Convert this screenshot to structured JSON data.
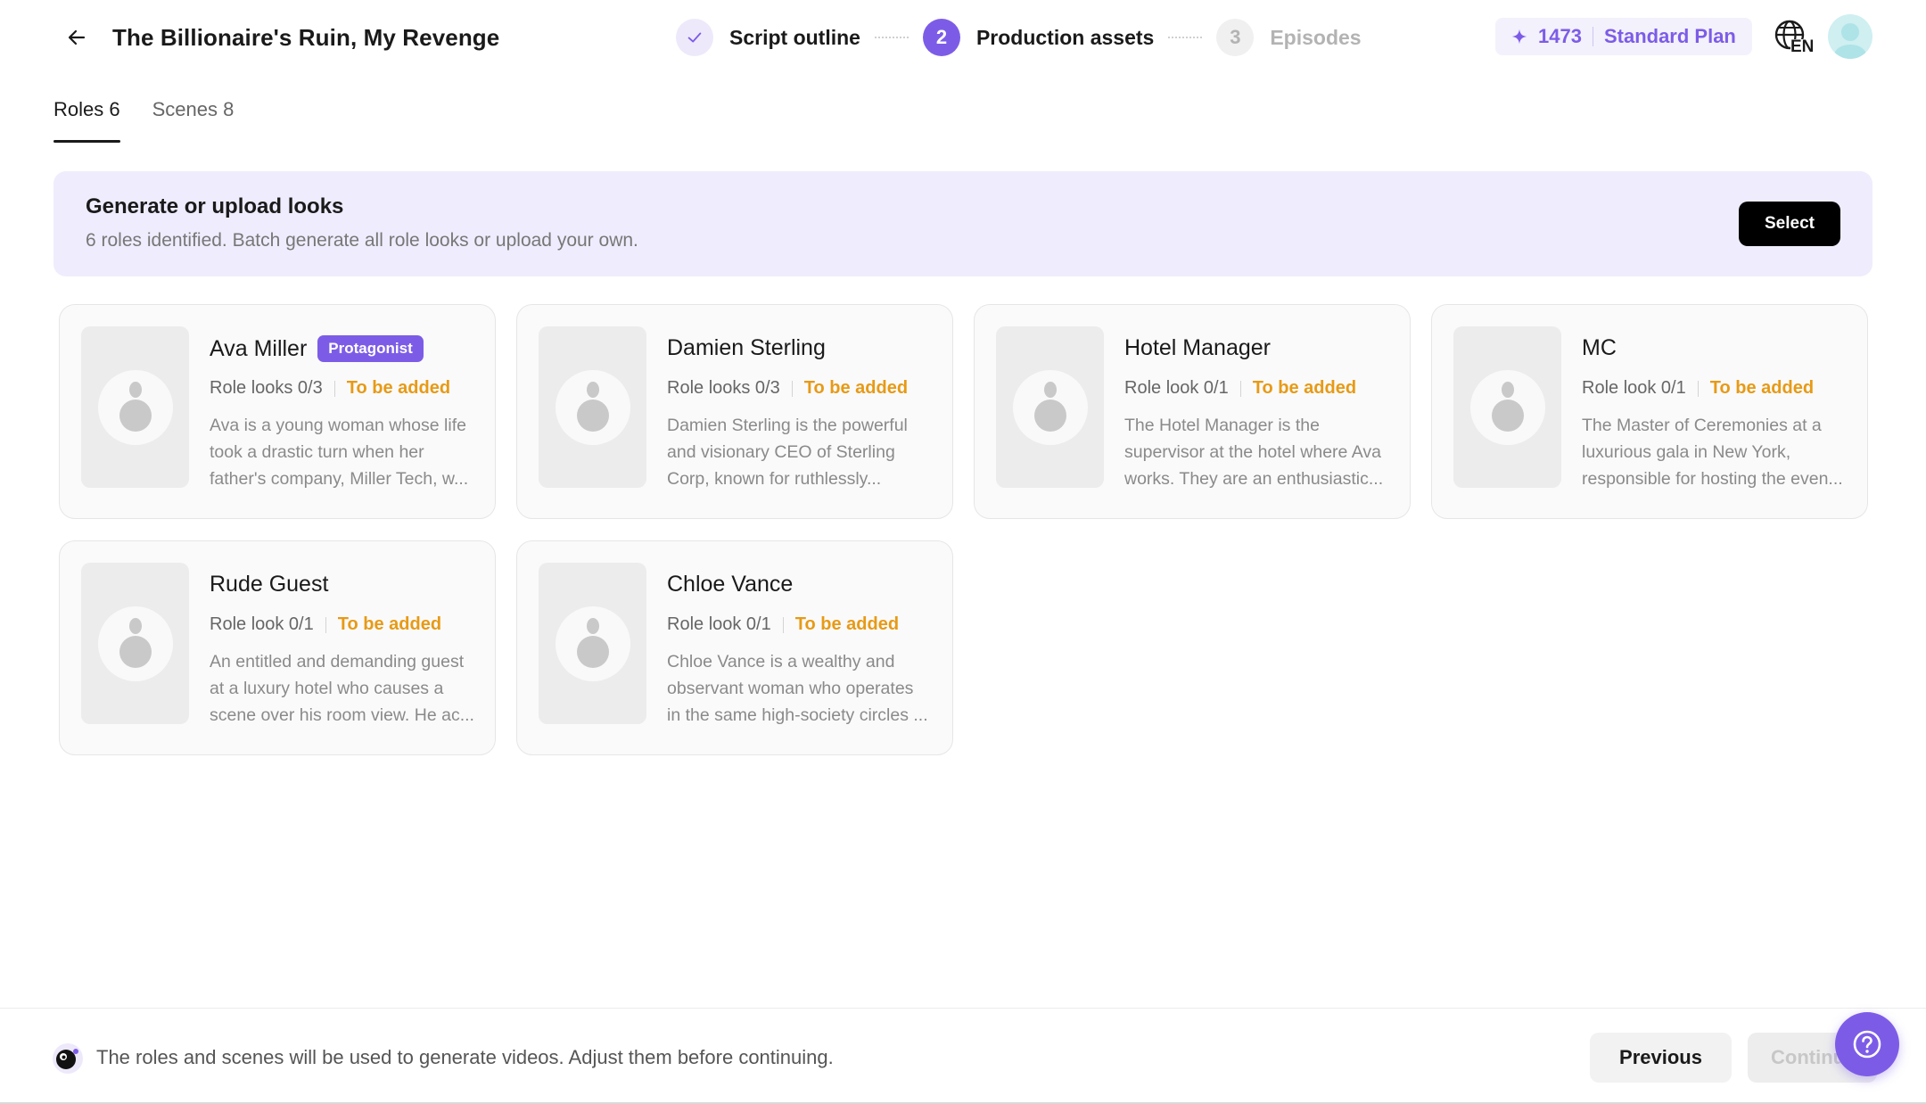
{
  "header": {
    "title": "The Billionaire's Ruin, My Revenge",
    "steps": [
      {
        "number": "1",
        "label": "Script outline",
        "state": "done"
      },
      {
        "number": "2",
        "label": "Production assets",
        "state": "active"
      },
      {
        "number": "3",
        "label": "Episodes",
        "state": "pending"
      }
    ],
    "credits": "1473",
    "plan": "Standard Plan",
    "language": "EN"
  },
  "tabs": [
    {
      "label": "Roles 6",
      "active": true
    },
    {
      "label": "Scenes 8",
      "active": false
    }
  ],
  "banner": {
    "title": "Generate or upload looks",
    "subtitle": "6 roles identified. Batch generate all role looks or upload your own.",
    "select_label": "Select"
  },
  "roles": [
    {
      "name": "Ava Miller",
      "badge": "Protagonist",
      "count": "Role looks 0/3",
      "status": "To be added",
      "desc_lines": [
        "Ava is a young woman whose life",
        "took a drastic turn when her",
        "father's company, Miller Tech, w..."
      ]
    },
    {
      "name": "Damien Sterling",
      "badge": "",
      "count": "Role looks 0/3",
      "status": "To be added",
      "desc_lines": [
        "Damien Sterling is the powerful",
        "and visionary CEO of Sterling",
        "Corp, known for ruthlessly..."
      ]
    },
    {
      "name": "Hotel Manager",
      "badge": "",
      "count": "Role look 0/1",
      "status": "To be added",
      "desc_lines": [
        "The Hotel Manager is the",
        "supervisor at the hotel where Ava",
        "works. They are an enthusiastic..."
      ]
    },
    {
      "name": "MC",
      "badge": "",
      "count": "Role look 0/1",
      "status": "To be added",
      "desc_lines": [
        "The Master of Ceremonies at a",
        "luxurious gala in New York,",
        "responsible for hosting the even..."
      ]
    },
    {
      "name": "Rude Guest",
      "badge": "",
      "count": "Role look 0/1",
      "status": "To be added",
      "desc_lines": [
        "An entitled and demanding guest",
        "at a luxury hotel who causes a",
        "scene over his room view. He ac..."
      ]
    },
    {
      "name": "Chloe Vance",
      "badge": "",
      "count": "Role look 0/1",
      "status": "To be added",
      "desc_lines": [
        "Chloe Vance is a wealthy and",
        "observant woman who operates",
        "in the same high-society circles ..."
      ]
    }
  ],
  "footer": {
    "message": "The roles and scenes will be used to generate videos. Adjust them before continuing.",
    "previous_label": "Previous",
    "continue_label": "Continue"
  },
  "colors": {
    "accent": "#7c5ce7",
    "banner_bg": "#efecfd",
    "status_orange": "#e79a16"
  }
}
